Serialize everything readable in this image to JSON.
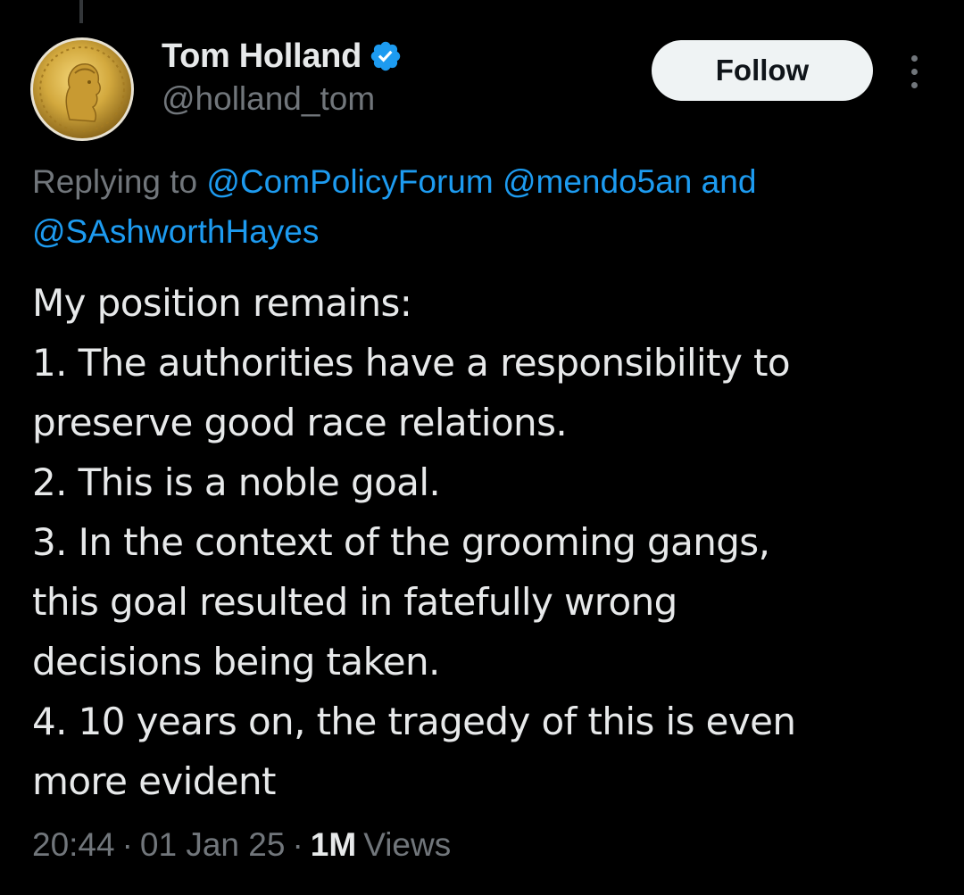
{
  "tweet": {
    "author": {
      "display_name": "Tom Holland",
      "handle": "@holland_tom",
      "verified": true,
      "avatar_icon": "gold-coin-avatar"
    },
    "follow_label": "Follow",
    "more_icon": "more-dots-icon",
    "reply_context": {
      "prefix": "Replying to",
      "mentions": [
        "@ComPolicyForum",
        "@mendo5an",
        "@SAshworthHayes"
      ],
      "conjunction": "and"
    },
    "body_lines": [
      "My position remains:",
      "1. The authorities have a responsibility to",
      "preserve good race relations.",
      "2. This is a noble goal.",
      "3. In the context of the grooming gangs,",
      "this goal resulted in fatefully wrong",
      "decisions being taken.",
      "4. 10 years on, the tragedy of this is even",
      "more evident"
    ],
    "meta": {
      "time": "20:44",
      "date": "01 Jan 25",
      "views_count": "1M",
      "views_label": "Views",
      "separator": "·"
    }
  },
  "colors": {
    "background": "#000000",
    "text_primary": "#e7e9ea",
    "text_secondary": "#71767b",
    "accent": "#1d9bf0",
    "follow_button_bg": "#eff3f4"
  }
}
